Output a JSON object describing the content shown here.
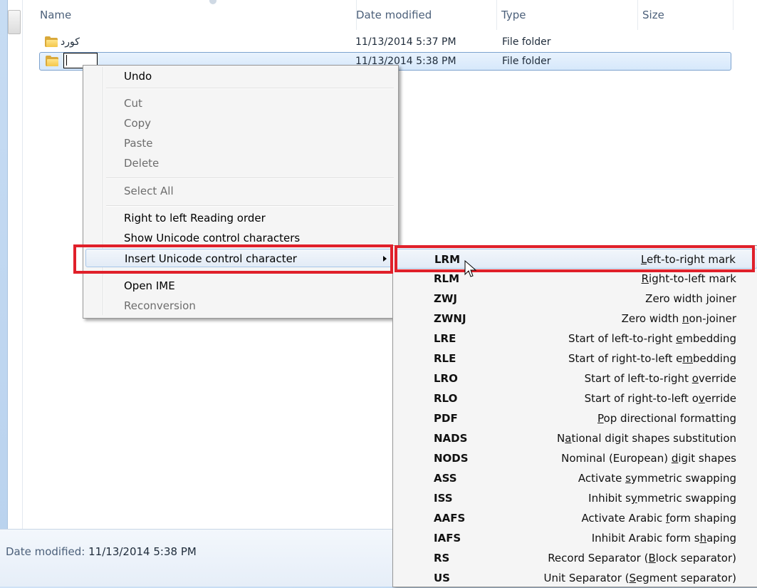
{
  "columns": {
    "name": "Name",
    "date_modified": "Date modified",
    "type": "Type",
    "size": "Size"
  },
  "files": [
    {
      "name": "كورد",
      "date": "11/13/2014 5:37 PM",
      "type": "File folder"
    },
    {
      "name": "",
      "date": "11/13/2014 5:38 PM",
      "type": "File folder"
    }
  ],
  "details": {
    "label": "Date modified:",
    "value": "11/13/2014 5:38 PM"
  },
  "context_menu": {
    "items": [
      {
        "label": "Undo",
        "enabled": true
      },
      {
        "label": "Cut",
        "enabled": false
      },
      {
        "label": "Copy",
        "enabled": false
      },
      {
        "label": "Paste",
        "enabled": false
      },
      {
        "label": "Delete",
        "enabled": false
      },
      {
        "label": "Select All",
        "enabled": false
      },
      {
        "label": "Right to left Reading order",
        "enabled": true
      },
      {
        "label": "Show Unicode control characters",
        "enabled": true
      },
      {
        "label": "Insert Unicode control character",
        "enabled": true
      },
      {
        "label": "Open IME",
        "enabled": true
      },
      {
        "label": "Reconversion",
        "enabled": false
      }
    ]
  },
  "submenu": {
    "items": [
      {
        "code": "LRM",
        "desc_pre": "",
        "desc_u": "L",
        "desc_post": "eft-to-right mark"
      },
      {
        "code": "RLM",
        "desc_pre": "",
        "desc_u": "R",
        "desc_post": "ight-to-left mark"
      },
      {
        "code": "ZWJ",
        "desc_pre": "Zero width joiner",
        "desc_u": "",
        "desc_post": ""
      },
      {
        "code": "ZWNJ",
        "desc_pre": "Zero width ",
        "desc_u": "n",
        "desc_post": "on-joiner"
      },
      {
        "code": "LRE",
        "desc_pre": "Start of left-to-right ",
        "desc_u": "e",
        "desc_post": "mbedding"
      },
      {
        "code": "RLE",
        "desc_pre": "Start of right-to-left e",
        "desc_u": "m",
        "desc_post": "bedding"
      },
      {
        "code": "LRO",
        "desc_pre": "Start of left-to-right ",
        "desc_u": "o",
        "desc_post": "verride"
      },
      {
        "code": "RLO",
        "desc_pre": "Start of right-to-left o",
        "desc_u": "v",
        "desc_post": "erride"
      },
      {
        "code": "PDF",
        "desc_pre": "",
        "desc_u": "P",
        "desc_post": "op directional formatting"
      },
      {
        "code": "NADS",
        "desc_pre": "N",
        "desc_u": "a",
        "desc_post": "tional digit shapes substitution"
      },
      {
        "code": "NODS",
        "desc_pre": "Nominal (European) ",
        "desc_u": "d",
        "desc_post": "igit shapes"
      },
      {
        "code": "ASS",
        "desc_pre": "Activate ",
        "desc_u": "s",
        "desc_post": "ymmetric swapping"
      },
      {
        "code": "ISS",
        "desc_pre": "Inhibit s",
        "desc_u": "y",
        "desc_post": "mmetric swapping"
      },
      {
        "code": "AAFS",
        "desc_pre": "Activate Arabic ",
        "desc_u": "f",
        "desc_post": "orm shaping"
      },
      {
        "code": "IAFS",
        "desc_pre": "Inhibit Arabic form s",
        "desc_u": "h",
        "desc_post": "aping"
      },
      {
        "code": "RS",
        "desc_pre": "Record Separator (",
        "desc_u": "B",
        "desc_post": "lock separator)"
      },
      {
        "code": "US",
        "desc_pre": "Unit Separator (",
        "desc_u": "S",
        "desc_post": "egment separator)"
      }
    ]
  },
  "colors": {
    "highlight_box": "#e0202a",
    "selection": "#d6e8fb"
  }
}
